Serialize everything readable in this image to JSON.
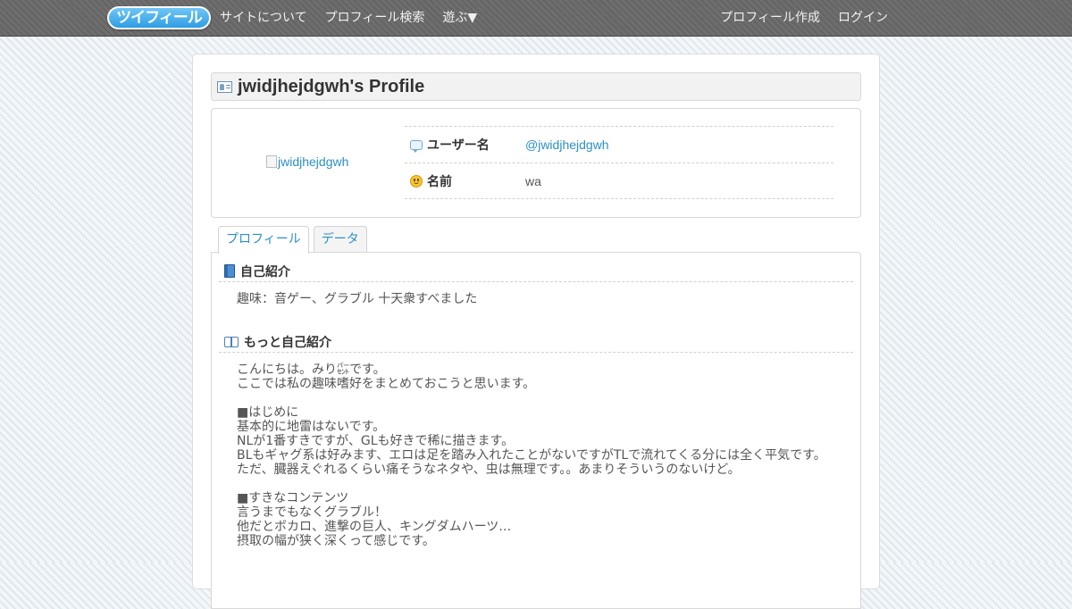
{
  "navbar": {
    "logo_text": "ツイフィール",
    "left_links": [
      "サイトについて",
      "プロフィール検索",
      "遊ぶ▼"
    ],
    "right_links": [
      "プロフィール作成",
      "ログイン"
    ]
  },
  "page": {
    "title": "jwidjhejdgwh's Profile"
  },
  "profile": {
    "avatar_alt": "jwidjhejdgwh",
    "rows": [
      {
        "label": "ユーザー名",
        "value": "@jwidjhejdgwh",
        "icon": "speech-bubble-icon"
      },
      {
        "label": "名前",
        "value": "wa",
        "icon": "smile-icon"
      }
    ]
  },
  "tabs": [
    {
      "label": "プロフィール",
      "active": true
    },
    {
      "label": "データ",
      "active": false
    }
  ],
  "sections": {
    "intro": {
      "heading": "自己紹介",
      "icon": "book-icon",
      "lines": [
        "趣味：音ゲー、グラブル 十天衆すべました"
      ]
    },
    "more_intro": {
      "heading": "もっと自己紹介",
      "icon": "open-book-icon",
      "lines": [
        "こんにちは。みり㌫です。",
        "ここでは私の趣味嗜好をまとめておこうと思います。",
        "",
        "■はじめに",
        "基本的に地雷はないです。",
        "NLが1番すきですが、GLも好きで稀に描きます。",
        "BLもギャグ系は好みます、エロは足を踏み入れたことがないですがTLで流れてくる分には全く平気です。",
        "ただ、臓器えぐれるくらい痛そうなネタや、虫は無理です。。あまりそういうのないけど。",
        "",
        "■すきなコンテンツ",
        "言うまでもなくグラブル！",
        "他だとボカロ、進撃の巨人、キングダムハーツ…",
        "摂取の幅が狭く深くって感じです。"
      ]
    }
  },
  "colors": {
    "link": "#2a8fc6",
    "navbar": "#6b6b6b"
  }
}
